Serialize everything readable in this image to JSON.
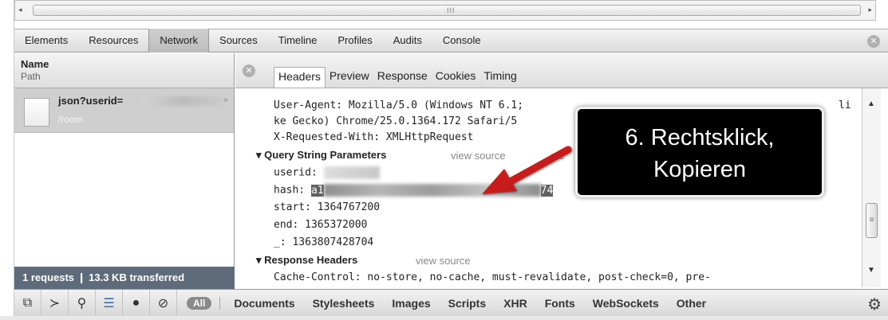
{
  "scrollbar": {
    "grip": "III",
    "left_arrow": "◂",
    "right_arrow": "▸"
  },
  "panel_tabs": [
    "Elements",
    "Resources",
    "Network",
    "Sources",
    "Timeline",
    "Profiles",
    "Audits",
    "Console"
  ],
  "active_panel": "Network",
  "close_symbol": "✕",
  "requests": {
    "header_name": "Name",
    "header_path": "Path",
    "row": {
      "name": "json?userid=",
      "suffix": "=",
      "path": "/room"
    },
    "summary": "1 requests  ❙  13.3 KB transferred"
  },
  "detail_tabs": [
    "Headers",
    "Preview",
    "Response",
    "Cookies",
    "Timing"
  ],
  "active_detail_tab": "Headers",
  "headers": {
    "ua_line1": "User-Agent: Mozilla/5.0 (Windows NT 6.1;",
    "ua_tail": "li",
    "ua_line2": "ke Gecko) Chrome/25.0.1364.172 Safari/5",
    "xrw": "X-Requested-With: XMLHttpRequest",
    "qsp_title": "Query String Parameters",
    "view_source": "view source",
    "view_partial": "vie",
    "userid_label": "userid:",
    "hash_label": "hash:",
    "hash_start": "a1",
    "hash_end": "74",
    "start": "start: 1364767200",
    "end": "end: 1365372000",
    "underscore": "_: 1363807428704",
    "resp_title": "Response Headers",
    "cache_line": "Cache-Control: no-store, no-cache, must-revalidate, post-check=0, pre-"
  },
  "callout": {
    "line1": "6. Rechtsklick,",
    "line2": "Kopieren"
  },
  "bottom_icons": [
    "dock-icon",
    "console-icon",
    "search-icon",
    "list-icon",
    "record-icon",
    "clear-icon"
  ],
  "bottom_glyphs": [
    "⧉",
    "≻",
    "⚲",
    "☰",
    "●",
    "⊘"
  ],
  "filter_all": "All",
  "filters": [
    "Documents",
    "Stylesheets",
    "Images",
    "Scripts",
    "XHR",
    "Fonts",
    "WebSockets",
    "Other"
  ],
  "gear": "⚙"
}
